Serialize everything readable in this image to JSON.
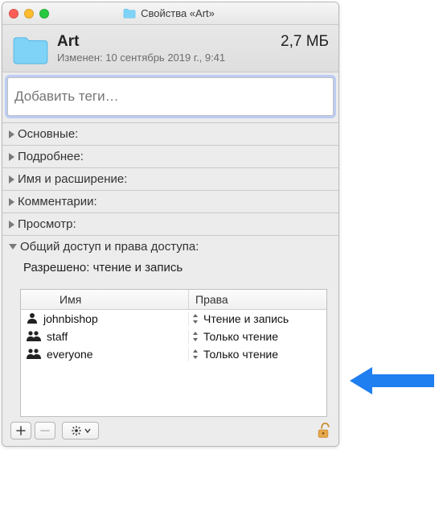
{
  "titlebar": {
    "title": "Свойства «Art»"
  },
  "header": {
    "name": "Art",
    "size": "2,7 МБ",
    "modified": "Изменен: 10 сентябрь 2019 г., 9:41"
  },
  "tags": {
    "placeholder": "Добавить теги…"
  },
  "sections": {
    "general": "Основные:",
    "more": "Подробнее:",
    "name_ext": "Имя и расширение:",
    "comments": "Комментарии:",
    "preview": "Просмотр:",
    "sharing": "Общий доступ и права доступа:"
  },
  "permissions": {
    "summary": "Разрешено: чтение и запись",
    "col_name": "Имя",
    "col_priv": "Права",
    "rows": [
      {
        "icon": "user",
        "name": "johnbishop",
        "priv": "Чтение и запись"
      },
      {
        "icon": "group",
        "name": "staff",
        "priv": "Только чтение"
      },
      {
        "icon": "group",
        "name": "everyone",
        "priv": "Только чтение"
      }
    ]
  },
  "footer": {
    "add": "＋",
    "remove": "－",
    "gear": "✱"
  }
}
